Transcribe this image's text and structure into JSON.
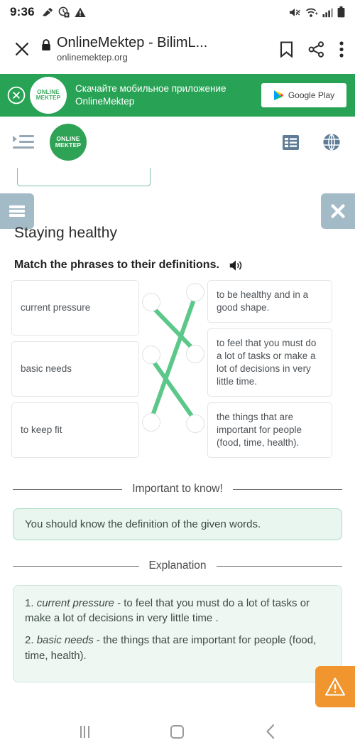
{
  "status_bar": {
    "time": "9:36",
    "left_icons": [
      "sweep-icon",
      "clock-badge-icon",
      "warning-triangle-icon"
    ],
    "right_icons": [
      "mute-icon",
      "wifi-icon",
      "signal-icon",
      "battery-icon"
    ]
  },
  "browser": {
    "close_label": "close-tab",
    "lock_icon": "lock-icon",
    "page_title": "OnlineMektep - BilimL...",
    "url": "onlinemektep.org",
    "actions": [
      "bookmark-icon",
      "share-icon",
      "overflow-menu-icon"
    ]
  },
  "promo": {
    "close_label": "dismiss-banner",
    "logo_line1": "ONLINE",
    "logo_line2": "MEKTEP",
    "text_line1": "Скачайте мобильное приложение",
    "text_line2": "OnlineMektep",
    "store_button": "Google Play",
    "background_color": "#28a355"
  },
  "site_header": {
    "menu_icon": "indent-list-icon",
    "logo_line1": "ONLINE",
    "logo_line2": "MEKTEP",
    "right_icons": [
      "list-view-icon",
      "language-globe-icon"
    ],
    "logo_color": "#2fa355"
  },
  "lesson": {
    "menu_button": "lesson-menu",
    "close_button": "lesson-close",
    "title": "Staying healthy",
    "toolbar_color": "#a3bac7"
  },
  "task": {
    "instruction": "Match the phrases to their definitions.",
    "audio_icon": "speaker-icon",
    "phrases": [
      "current pressure",
      "basic needs",
      "to keep fit"
    ],
    "definitions": [
      "to be healthy and in a good shape.",
      "to feel that you must do a lot of tasks or make a lot of decisions in very little time.",
      "the things that are important for people (food, time, health)."
    ],
    "connection_color": "#5bc88a",
    "connections": [
      {
        "from": 0,
        "to": 1
      },
      {
        "from": 1,
        "to": 2
      },
      {
        "from": 2,
        "to": 0
      }
    ]
  },
  "important": {
    "divider_label": "Important to know!",
    "text": "You should know the definition of the given words.",
    "background_color": "#e9f6ef",
    "border_color": "#a8dcc3"
  },
  "explanation": {
    "divider_label": "Explanation",
    "items": [
      {
        "number": "1.",
        "term": "current pressure",
        "text": " - to feel that you must do a lot of tasks or make a lot of decisions in very little time ."
      },
      {
        "number": "2.",
        "term": "basic needs",
        "text": " - the things that are important for people (food, time, health)."
      }
    ]
  },
  "warning_button": {
    "icon": "warning-triangle-icon",
    "color": "#f1962f"
  },
  "android_nav": {
    "recents": "recents-button",
    "home": "home-button",
    "back": "back-button"
  }
}
